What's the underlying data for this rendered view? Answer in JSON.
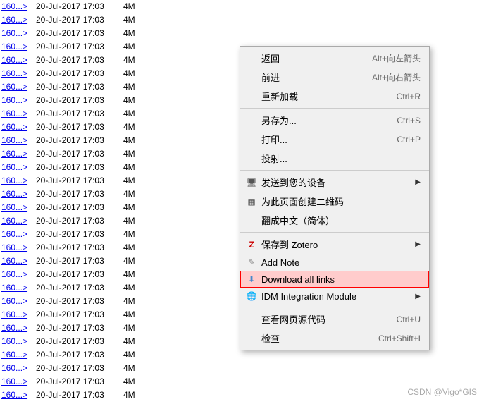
{
  "fileList": {
    "rows": [
      {
        "link": "160...>",
        "date": "20-Jul-2017 17:03",
        "size": "4M"
      },
      {
        "link": "160...>",
        "date": "20-Jul-2017 17:03",
        "size": "4M"
      },
      {
        "link": "160...>",
        "date": "20-Jul-2017 17:03",
        "size": "4M"
      },
      {
        "link": "160...>",
        "date": "20-Jul-2017 17:03",
        "size": "4M"
      },
      {
        "link": "160...>",
        "date": "20-Jul-2017 17:03",
        "size": "4M"
      },
      {
        "link": "160...>",
        "date": "20-Jul-2017 17:03",
        "size": "4M"
      },
      {
        "link": "160...>",
        "date": "20-Jul-2017 17:03",
        "size": "4M"
      },
      {
        "link": "160...>",
        "date": "20-Jul-2017 17:03",
        "size": "4M"
      },
      {
        "link": "160...>",
        "date": "20-Jul-2017 17:03",
        "size": "4M"
      },
      {
        "link": "160...>",
        "date": "20-Jul-2017 17:03",
        "size": "4M"
      },
      {
        "link": "160...>",
        "date": "20-Jul-2017 17:03",
        "size": "4M"
      },
      {
        "link": "160...>",
        "date": "20-Jul-2017 17:03",
        "size": "4M"
      },
      {
        "link": "160...>",
        "date": "20-Jul-2017 17:03",
        "size": "4M"
      },
      {
        "link": "160...>",
        "date": "20-Jul-2017 17:03",
        "size": "4M"
      },
      {
        "link": "160...>",
        "date": "20-Jul-2017 17:03",
        "size": "4M"
      },
      {
        "link": "160...>",
        "date": "20-Jul-2017 17:03",
        "size": "4M"
      },
      {
        "link": "160...>",
        "date": "20-Jul-2017 17:03",
        "size": "4M"
      },
      {
        "link": "160...>",
        "date": "20-Jul-2017 17:03",
        "size": "4M"
      },
      {
        "link": "160...>",
        "date": "20-Jul-2017 17:03",
        "size": "4M"
      },
      {
        "link": "160...>",
        "date": "20-Jul-2017 17:03",
        "size": "4M"
      },
      {
        "link": "160...>",
        "date": "20-Jul-2017 17:03",
        "size": "4M"
      },
      {
        "link": "160...>",
        "date": "20-Jul-2017 17:03",
        "size": "4M"
      },
      {
        "link": "160...>",
        "date": "20-Jul-2017 17:03",
        "size": "4M"
      },
      {
        "link": "160...>",
        "date": "20-Jul-2017 17:03",
        "size": "4M"
      },
      {
        "link": "160...>",
        "date": "20-Jul-2017 17:03",
        "size": "4M"
      },
      {
        "link": "160...>",
        "date": "20-Jul-2017 17:03",
        "size": "4M"
      },
      {
        "link": "160...>",
        "date": "20-Jul-2017 17:03",
        "size": "4M"
      },
      {
        "link": "160...>",
        "date": "20-Jul-2017 17:03",
        "size": "4M"
      },
      {
        "link": "160...>",
        "date": "20-Jul-2017 17:03",
        "size": "4M"
      },
      {
        "link": "160...>",
        "date": "20-Jul-2017 17:03",
        "size": "4M"
      }
    ]
  },
  "contextMenu": {
    "items": [
      {
        "id": "back",
        "label": "返回",
        "shortcut": "Alt+向左箭头",
        "hasIcon": false,
        "hasArrow": false,
        "separator_after": false
      },
      {
        "id": "forward",
        "label": "前进",
        "shortcut": "Alt+向右箭头",
        "hasIcon": false,
        "hasArrow": false,
        "separator_after": false
      },
      {
        "id": "reload",
        "label": "重新加载",
        "shortcut": "Ctrl+R",
        "hasIcon": false,
        "hasArrow": false,
        "separator_after": true
      },
      {
        "id": "save-as",
        "label": "另存为...",
        "shortcut": "Ctrl+S",
        "hasIcon": false,
        "hasArrow": false,
        "separator_after": false
      },
      {
        "id": "print",
        "label": "打印...",
        "shortcut": "Ctrl+P",
        "hasIcon": false,
        "hasArrow": false,
        "separator_after": false
      },
      {
        "id": "cast",
        "label": "投射...",
        "shortcut": "",
        "hasIcon": false,
        "hasArrow": false,
        "separator_after": true
      },
      {
        "id": "send-to-device",
        "label": "发送到您的设备",
        "shortcut": "",
        "hasIcon": true,
        "iconType": "monitor",
        "hasArrow": true,
        "separator_after": false
      },
      {
        "id": "create-qr",
        "label": "为此页面创建二维码",
        "shortcut": "",
        "hasIcon": true,
        "iconType": "qr",
        "hasArrow": false,
        "separator_after": false
      },
      {
        "id": "translate",
        "label": "翻成中文（简体）",
        "shortcut": "",
        "hasIcon": false,
        "hasArrow": false,
        "separator_after": true
      },
      {
        "id": "zotero",
        "label": "保存到 Zotero",
        "shortcut": "",
        "hasIcon": true,
        "iconType": "zotero",
        "hasArrow": true,
        "separator_after": false
      },
      {
        "id": "add-note",
        "label": "Add Note",
        "shortcut": "",
        "hasIcon": true,
        "iconType": "note",
        "hasArrow": false,
        "separator_after": false
      },
      {
        "id": "download-all-links",
        "label": "Download all links",
        "shortcut": "",
        "hasIcon": true,
        "iconType": "download",
        "hasArrow": false,
        "highlighted": true,
        "separator_after": false
      },
      {
        "id": "idm",
        "label": "IDM Integration Module",
        "shortcut": "",
        "hasIcon": true,
        "iconType": "idm",
        "hasArrow": true,
        "separator_after": true
      },
      {
        "id": "view-source",
        "label": "查看网页源代码",
        "shortcut": "Ctrl+U",
        "hasIcon": false,
        "hasArrow": false,
        "separator_after": false
      },
      {
        "id": "inspect",
        "label": "检查",
        "shortcut": "Ctrl+Shift+I",
        "hasIcon": false,
        "hasArrow": false,
        "separator_after": false
      }
    ]
  },
  "watermark": {
    "text": "CSDN @Vigo*GIS"
  }
}
